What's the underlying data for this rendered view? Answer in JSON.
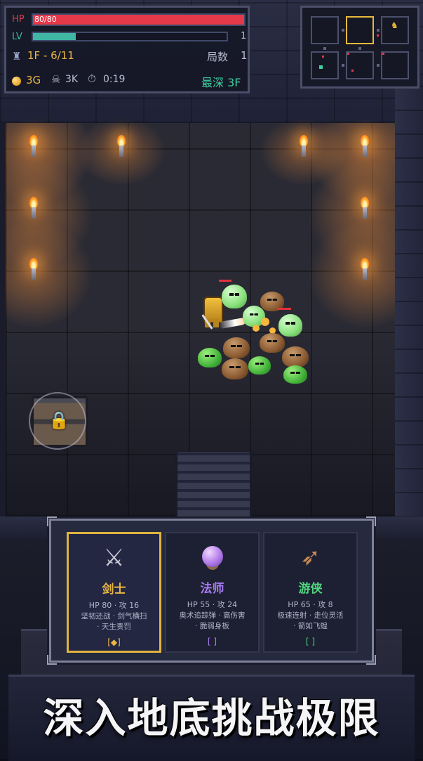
{
  "hud": {
    "hp_label": "HP",
    "hp_text": "80/80",
    "hp_fraction": 1.0,
    "lv_label": "LV",
    "lv_value": "1",
    "lv_fraction": 0.22,
    "floor_text": "1F - 6/11",
    "rounds_label": "局数",
    "rounds_value": "1",
    "gold": "3G",
    "kills": "3K",
    "timer": "0:19",
    "deepest": "最深 3F",
    "colors": {
      "hp": "#e5394a",
      "lv": "#3fb7a3",
      "gold": "#e8b645",
      "deepest": "#3fd0a0"
    }
  },
  "minimap": {
    "rooms": 6,
    "current_room_index": 1
  },
  "classes": [
    {
      "icon": "crossed-swords-icon",
      "glyph": "⚔",
      "name": "剑士",
      "name_color": "#e8b645",
      "stats": "HP 80 · 攻 16",
      "skills_1": "坚韧还战 · 剑气横扫",
      "skills_2": "· 天生责罚",
      "mark": "[◆]",
      "selected": true
    },
    {
      "icon": "crystal-ball-icon",
      "glyph": "●",
      "name": "法师",
      "name_color": "#a77cf0",
      "stats": "HP 55 · 攻 24",
      "skills_1": "奥术追踪弹 · 高伤害",
      "skills_2": "· 脆弱身板",
      "mark": "[ ]",
      "selected": false
    },
    {
      "icon": "bow-icon",
      "glyph": "➶",
      "name": "游侠",
      "name_color": "#4fd67d",
      "stats": "HP 65 · 攻 8",
      "skills_1": "极速连射 · 走位灵活",
      "skills_2": "· 箭如飞蝗",
      "mark": "[ ]",
      "selected": false
    }
  ],
  "headline": "深入地底挑战极限"
}
